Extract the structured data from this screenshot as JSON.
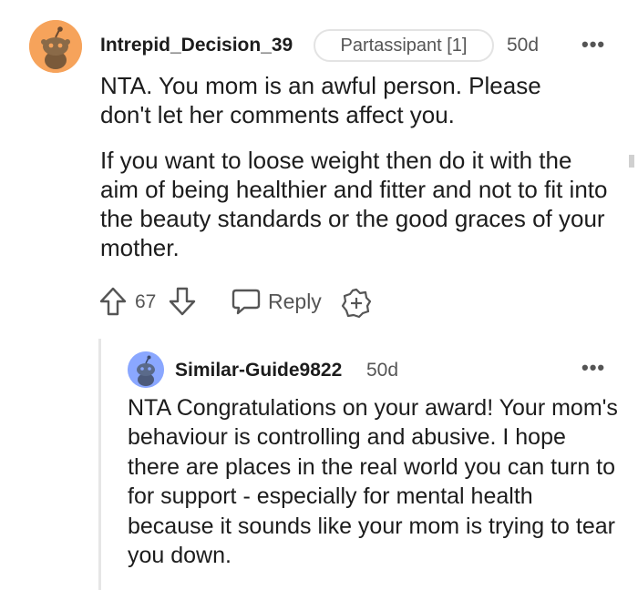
{
  "comment": {
    "username": "Intrepid_Decision_39",
    "flair": "Partassipant [1]",
    "age": "50d",
    "more_icon": "more-dots-icon",
    "paragraphs": [
      "NTA. You mom is an awful person. Please don't let her comments affect you.",
      "If you want to loose weight then do it with the aim of being healthier and fitter and not to fit into the beauty standards or the good graces of your mother."
    ],
    "actions": {
      "upvote_icon": "upvote-arrow-icon",
      "score": "67",
      "downvote_icon": "downvote-arrow-icon",
      "reply_icon": "reply-bubble-icon",
      "reply_label": "Reply",
      "award_icon": "add-award-icon"
    }
  },
  "reply": {
    "username": "Similar-Guide9822",
    "age": "50d",
    "more_icon": "more-dots-icon",
    "text": "NTA Congratulations on your award! Your mom's behaviour is controlling and abusive. I hope there are places in the real world you can turn to for support - especially for mental health because it sounds like your mom is trying to tear you down."
  },
  "colors": {
    "avatar_orange": "#f6a35b",
    "avatar_blue": "#8aa7ff",
    "text_primary": "#1c1c1c",
    "text_secondary": "#555555",
    "thread_line": "#e6e6e6"
  }
}
